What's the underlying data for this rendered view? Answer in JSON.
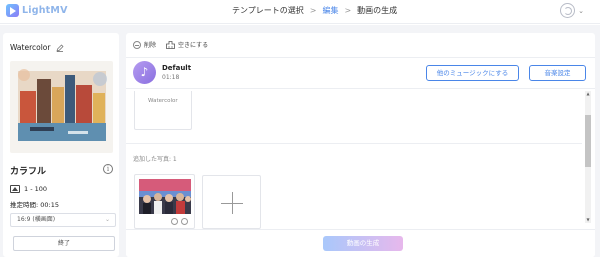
{
  "app": {
    "name": "LightMV"
  },
  "steps": [
    {
      "label": "テンプレートの選択"
    },
    {
      "label": "編集"
    },
    {
      "label": "動画の生成"
    }
  ],
  "left_panel": {
    "theme_title": "Watercolor",
    "style_name": "カラフル",
    "photo_range": "1 - 100",
    "duration": "推定時間: 00:15",
    "ratio_selected": "16:9 (横画面)",
    "finish_label": "終了"
  },
  "toolbar": {
    "delete_label": "削除",
    "clear_label": "空きにする"
  },
  "music": {
    "name": "Default",
    "time": "01:18",
    "other_music_label": "他のミュージックにする",
    "music_settings_label": "音楽設定"
  },
  "intro_card": {
    "label": "Watercolor"
  },
  "added_photos_label": "追加した写真: 1",
  "generate_label": "動画の生成",
  "colors": {
    "accent": "#4a86e8",
    "logo": "#8fb5ea",
    "generate_start": "#a9c8fb",
    "generate_end": "#e7b8ec",
    "music_disc": "#8a6fe0"
  }
}
